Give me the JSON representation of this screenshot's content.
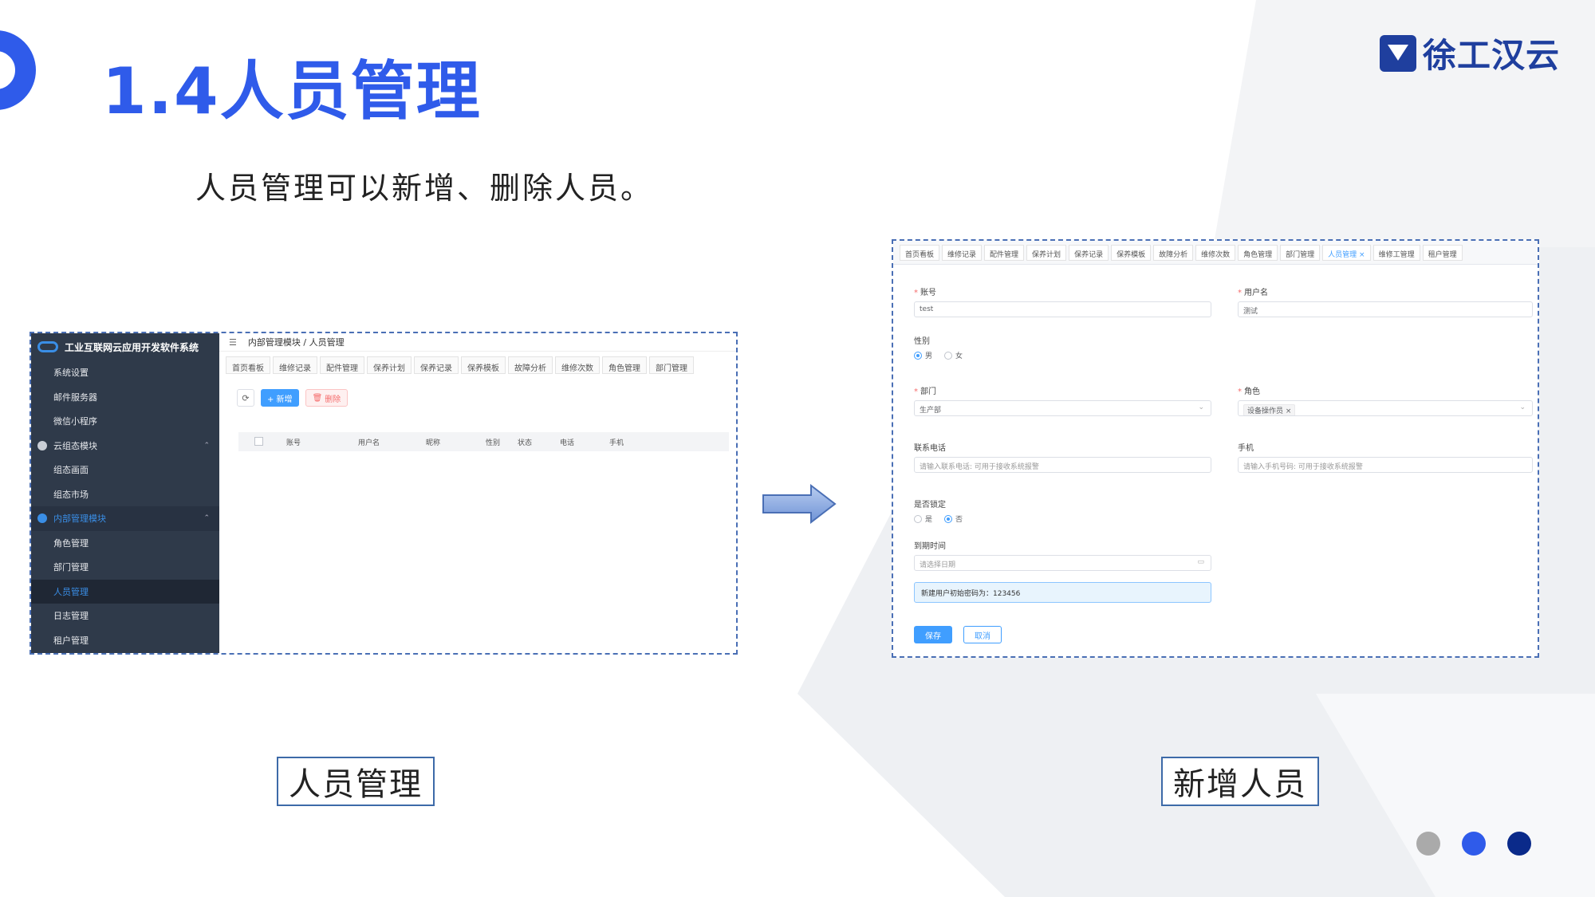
{
  "slide": {
    "title": "1.4人员管理",
    "subtitle": "人员管理可以新增、删除人员。",
    "logo_text": "徐工汉云",
    "caption_left": "人员管理",
    "caption_right": "新增人员",
    "colors": {
      "accent": "#2f5bea",
      "logo": "#1f3f9e",
      "dot_gray": "#aaaaaa",
      "dot_blue": "#2f5bea",
      "dot_navy": "#0a2a8a"
    }
  },
  "left_app": {
    "system_title": "工业互联网云应用开发软件系统",
    "sidebar": [
      {
        "label": "系统设置",
        "type": "item"
      },
      {
        "label": "邮件服务器",
        "type": "item"
      },
      {
        "label": "微信小程序",
        "type": "item"
      },
      {
        "label": "云组态模块",
        "type": "group"
      },
      {
        "label": "组态画面",
        "type": "item"
      },
      {
        "label": "组态市场",
        "type": "item"
      },
      {
        "label": "内部管理模块",
        "type": "group-open"
      },
      {
        "label": "角色管理",
        "type": "item"
      },
      {
        "label": "部门管理",
        "type": "item"
      },
      {
        "label": "人员管理",
        "type": "active"
      },
      {
        "label": "日志管理",
        "type": "item"
      },
      {
        "label": "租户管理",
        "type": "item"
      }
    ],
    "breadcrumb": "内部管理模块 / 人员管理",
    "tabs": [
      "首页看板",
      "维修记录",
      "配件管理",
      "保养计划",
      "保养记录",
      "保养模板",
      "故障分析",
      "维修次数",
      "角色管理",
      "部门管理"
    ],
    "add_label": "+ 新增",
    "delete_label": "删除",
    "columns": [
      "账号",
      "用户名",
      "昵称",
      "性别",
      "状态",
      "电话",
      "手机"
    ]
  },
  "right_app": {
    "tabs": [
      "首页看板",
      "维修记录",
      "配件管理",
      "保养计划",
      "保养记录",
      "保养模板",
      "故障分析",
      "维修次数",
      "角色管理",
      "部门管理",
      "人员管理 ×",
      "维修工管理",
      "租户管理"
    ],
    "active_tab": 10,
    "form": {
      "account_label": "账号",
      "account_value": "test",
      "username_label": "用户名",
      "username_value": "测试",
      "gender_label": "性别",
      "gender_male": "男",
      "gender_female": "女",
      "dept_label": "部门",
      "dept_value": "生产部",
      "role_label": "角色",
      "role_value": "设备操作员",
      "phone_label": "联系电话",
      "phone_placeholder": "请输入联系电话: 可用于接收系统报警",
      "mobile_label": "手机",
      "mobile_placeholder": "请输入手机号码: 可用于接收系统报警",
      "locked_label": "是否锁定",
      "locked_yes": "是",
      "locked_no": "否",
      "expire_label": "到期时间",
      "expire_placeholder": "请选择日期",
      "notice": "新建用户初始密码为：123456",
      "save": "保存",
      "cancel": "取消"
    }
  }
}
